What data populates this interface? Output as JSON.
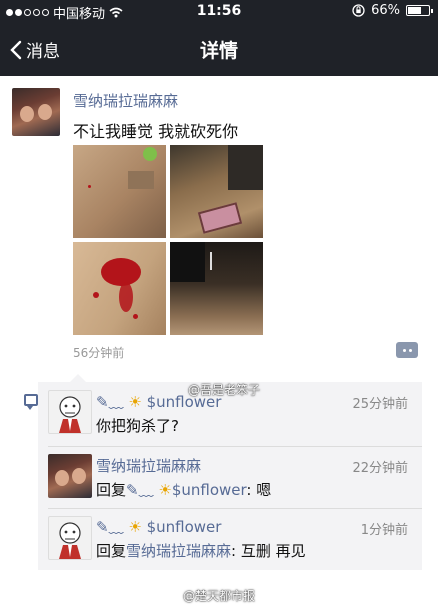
{
  "status": {
    "carrier": "中国移动",
    "time": "11:56",
    "battery": "66%",
    "battery_level": 0.66
  },
  "nav": {
    "back_label": "消息",
    "title": "详情"
  },
  "post": {
    "author": "雪纳瑞拉瑞麻麻",
    "text": "不让我睡觉 我就砍死你",
    "time": "56分钟前",
    "photos": [
      "floor-photo-1",
      "floor-photo-2",
      "blood-photo",
      "dark-floor-photo"
    ]
  },
  "comments": [
    {
      "name_prefix": "✎﹏",
      "name_sun": "☀",
      "name": "$unflower",
      "text": "你把狗杀了?",
      "time": "25分钟前"
    },
    {
      "name": "雪纳瑞拉瑞麻麻",
      "reply_prefix": "回复",
      "reply_target_prefix": "✎﹏ ",
      "reply_target_sun": "☀",
      "reply_target": "$unflower",
      "text": ": 嗯",
      "time": "22分钟前"
    },
    {
      "name_prefix": "✎﹏",
      "name_sun": "☀",
      "name": "$unflower",
      "reply_prefix": "回复",
      "reply_target": "雪纳瑞拉瑞麻麻",
      "text": ": 互删  再见",
      "time": "1分钟前"
    }
  ],
  "watermarks": {
    "middle": "@吾是老笨子",
    "bottom": "@楚天都市报"
  },
  "colors": {
    "nav_bg": "#1f2228",
    "link": "#576b95",
    "comment_bg": "#f3f3f5"
  }
}
